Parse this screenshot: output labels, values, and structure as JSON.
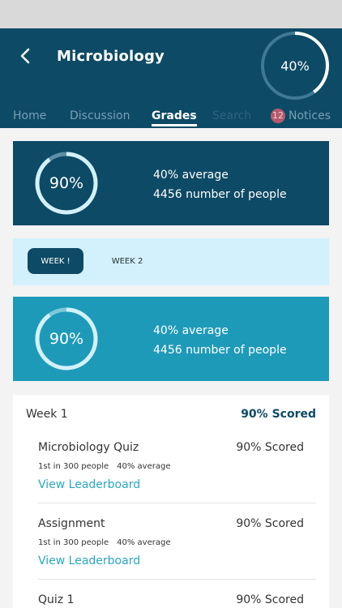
{
  "header": {
    "title": "Microbiology",
    "progress_label": "40%",
    "progress": 0.4
  },
  "tabs": [
    {
      "label": "Home"
    },
    {
      "label": "Discussion"
    },
    {
      "label": "Grades"
    },
    {
      "label": "Search"
    },
    {
      "label": "Notices",
      "badge": "12"
    }
  ],
  "summary_cards": [
    {
      "score_label": "90%",
      "score": 0.9,
      "average": "40% average",
      "people": "4456 number of people",
      "color": "#0d4a66"
    },
    {
      "score_label": "90%",
      "score": 0.9,
      "average": "40% average",
      "people": "4456 number of people",
      "color": "#1e9ab9"
    }
  ],
  "weeks": [
    {
      "label": "WEEK !"
    },
    {
      "label": "WEEK 2"
    }
  ],
  "results": {
    "week_label": "Week 1",
    "week_score": "90% Scored",
    "items": [
      {
        "name": "Microbiology Quiz",
        "score": "90% Scored",
        "rank": "1st in 300 people",
        "average": "40% average",
        "link": "View Leaderboard"
      },
      {
        "name": "Assignment",
        "score": "90% Scored",
        "rank": "1st in 300 people",
        "average": "40% average",
        "link": "View Leaderboard"
      },
      {
        "name": "Quiz 1",
        "score": "90% Scored"
      }
    ]
  }
}
